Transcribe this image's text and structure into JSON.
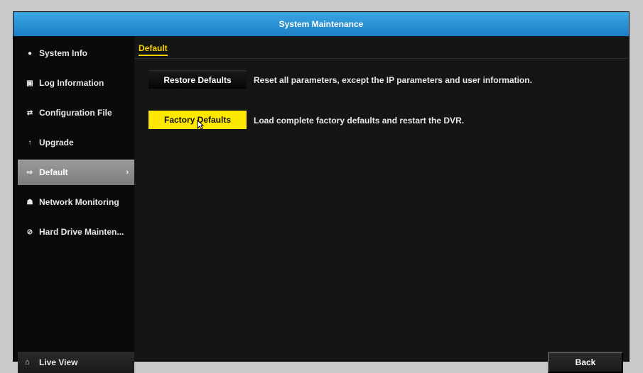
{
  "window": {
    "title": "System Maintenance"
  },
  "sidebar": {
    "items": [
      {
        "label": "System Info",
        "icon": "info-icon"
      },
      {
        "label": "Log Information",
        "icon": "log-icon"
      },
      {
        "label": "Configuration File",
        "icon": "config-file-icon"
      },
      {
        "label": "Upgrade",
        "icon": "upgrade-icon"
      },
      {
        "label": "Default",
        "icon": "default-icon",
        "active": true
      },
      {
        "label": "Network Monitoring",
        "icon": "network-icon"
      },
      {
        "label": "Hard Drive Mainten...",
        "icon": "hdd-icon"
      }
    ],
    "live_view": {
      "label": "Live View",
      "icon": "home-icon"
    }
  },
  "main": {
    "tab": "Default",
    "restore": {
      "button": "Restore Defaults",
      "description": "Reset all parameters, except the IP parameters and user information."
    },
    "factory": {
      "button": "Factory Defaults",
      "description": "Load complete factory defaults and restart the DVR."
    },
    "back": "Back"
  },
  "colors": {
    "titlebar": "#1b7fc4",
    "accent_yellow": "#ffe800",
    "active_item": "#8c8c8c"
  }
}
